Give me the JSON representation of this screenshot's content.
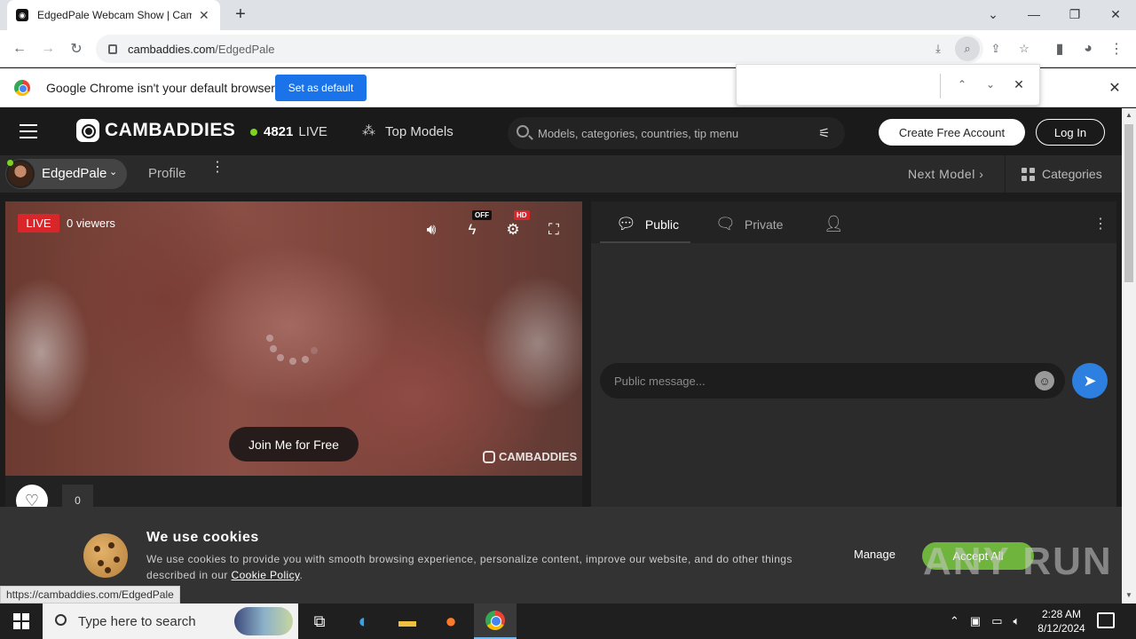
{
  "browser": {
    "tab_title": "EdgedPale Webcam Show | Cam",
    "tab_close": "✕",
    "new_tab": "+",
    "url_host": "cambaddies.com",
    "url_path": "/EdgedPale",
    "window_min": "—",
    "window_restore": "❐",
    "window_close": "✕",
    "tab_search": "⌄",
    "status_url": "https://cambaddies.com/EdgedPale"
  },
  "infobar": {
    "message": "Google Chrome isn't your default browser",
    "set_default": "Set as default",
    "close": "✕"
  },
  "findbar": {
    "up": "⌃",
    "down": "⌄",
    "close": "✕"
  },
  "site": {
    "logo_text": "CAMBADDIES",
    "live_count": "4821",
    "live_label": "LIVE",
    "top_models": "Top Models",
    "search_placeholder": "Models, categories, countries, tip menu",
    "create_account": "Create Free Account",
    "log_in": "Log In",
    "model_name": "EdgedPale",
    "profile": "Profile",
    "next_model": "Next Model",
    "categories": "Categories"
  },
  "player": {
    "live_badge": "LIVE",
    "viewers": "0 viewers",
    "off_badge": "OFF",
    "hd_badge": "HD",
    "join_button": "Join Me for Free",
    "watermark": "CAMBADDIES",
    "like_count": "0"
  },
  "chat": {
    "tab_public": "Public",
    "tab_private": "Private",
    "message_placeholder": "Public message..."
  },
  "cookies": {
    "title": "We use cookies",
    "text_before": "We use cookies to provide you with smooth browsing experience, personalize content, improve our website, and do other things described in our ",
    "policy_link": "Cookie Policy",
    "text_after": ".",
    "manage": "Manage",
    "accept_all": "Accept All"
  },
  "watermark_overlay": "ANY RUN",
  "taskbar": {
    "search_placeholder": "Type here to search",
    "time": "2:28 AM",
    "date": "8/12/2024"
  },
  "colors": {
    "accent_blue": "#1a73e8",
    "live_red": "#d9262b",
    "online_green": "#7ed321",
    "accept_green": "#6fb43c",
    "send_blue": "#2d7fe0"
  }
}
